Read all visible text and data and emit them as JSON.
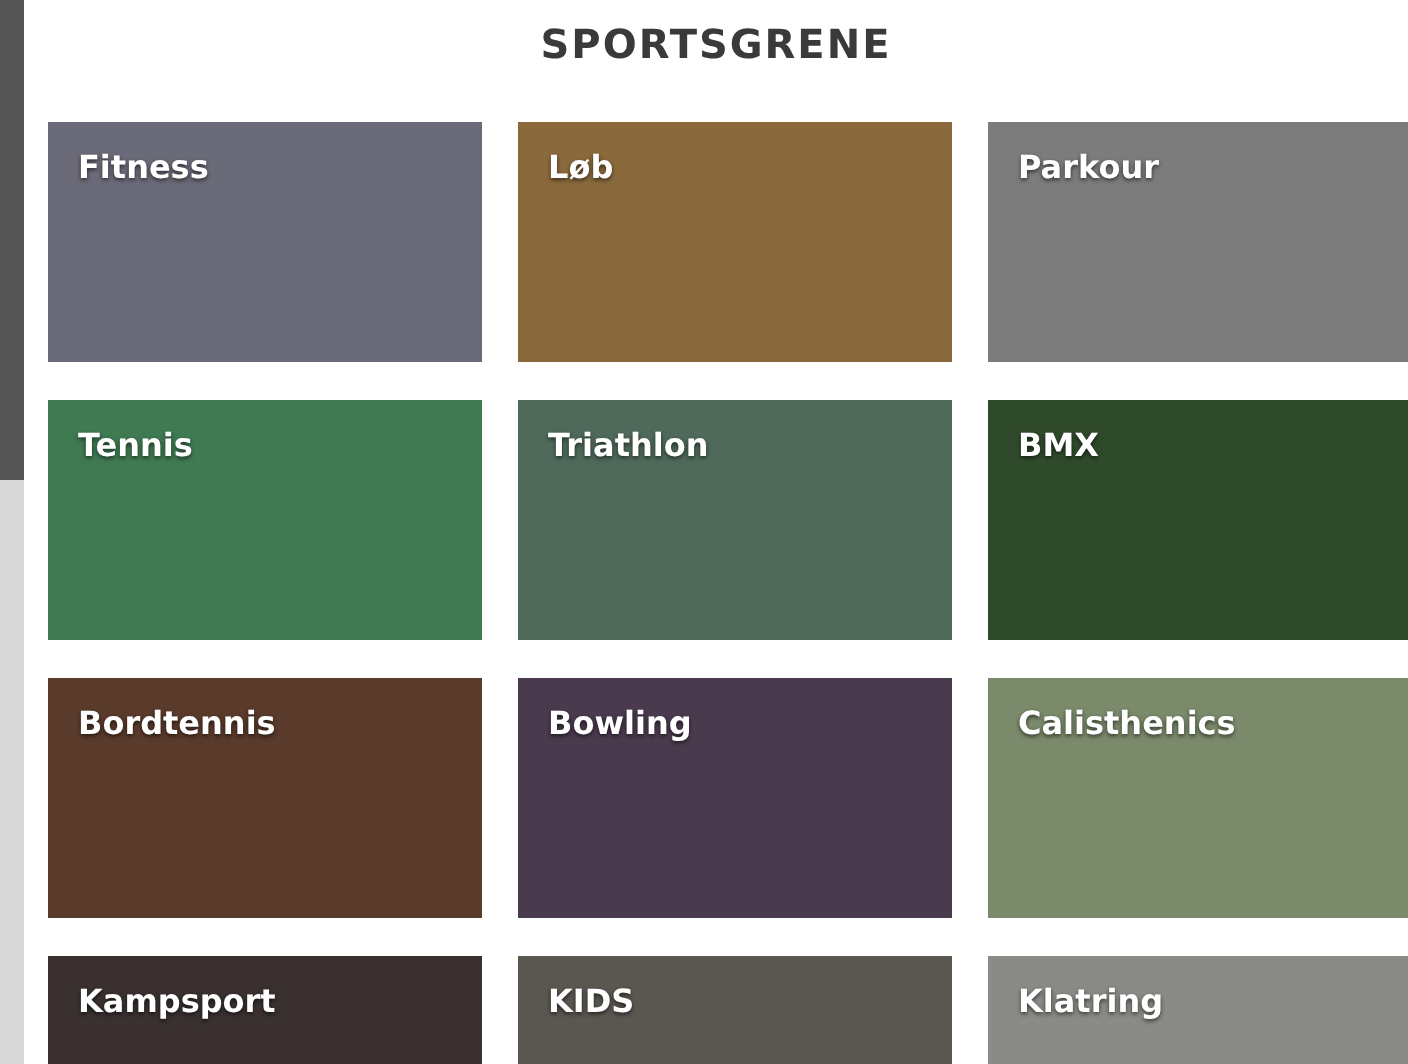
{
  "title": "SPORTSGRENE",
  "sports": [
    {
      "label": "Fitness"
    },
    {
      "label": "Løb"
    },
    {
      "label": "Parkour"
    },
    {
      "label": "Tennis"
    },
    {
      "label": "Triathlon"
    },
    {
      "label": "BMX"
    },
    {
      "label": "Bordtennis"
    },
    {
      "label": "Bowling"
    },
    {
      "label": "Calisthenics"
    },
    {
      "label": "Kampsport"
    },
    {
      "label": "KIDS"
    },
    {
      "label": "Klatring"
    }
  ]
}
